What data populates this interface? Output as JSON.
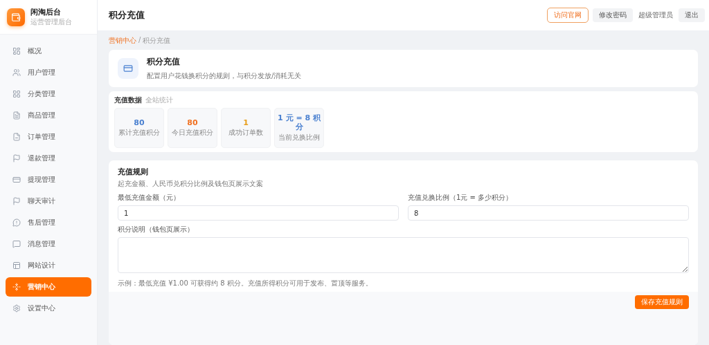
{
  "brand": {
    "title": "闲淘后台",
    "subtitle": "运营管理后台"
  },
  "sidebar": {
    "items": [
      {
        "label": "概况",
        "selected": false
      },
      {
        "label": "用户管理",
        "selected": false
      },
      {
        "label": "分类管理",
        "selected": false
      },
      {
        "label": "商品管理",
        "selected": false
      },
      {
        "label": "订单管理",
        "selected": false
      },
      {
        "label": "退款管理",
        "selected": false
      },
      {
        "label": "提现管理",
        "selected": false
      },
      {
        "label": "聊天审计",
        "selected": false
      },
      {
        "label": "售后管理",
        "selected": false
      },
      {
        "label": "消息管理",
        "selected": false
      },
      {
        "label": "网站设计",
        "selected": false
      },
      {
        "label": "营销中心",
        "selected": true
      },
      {
        "label": "设置中心",
        "selected": false
      }
    ]
  },
  "header": {
    "title": "积分充值",
    "visit_button": "访问官网",
    "password_button": "修改密码",
    "user": "超级管理员",
    "logout_button": "退出"
  },
  "breadcrumb": {
    "parent": "营销中心",
    "separator": "/",
    "current": "积分充值"
  },
  "intro": {
    "title": "积分充值",
    "description": "配置用户花钱换积分的规则，与积分发放/消耗无关"
  },
  "stats": {
    "title": "充值数据",
    "note": "全站统计",
    "cards": [
      {
        "value": "80",
        "label": "累计充值积分",
        "color": "#4a80d0"
      },
      {
        "value": "80",
        "label": "今日充值积分",
        "color": "#f07020"
      },
      {
        "value": "1",
        "label": "成功订单数",
        "color": "#e8a020"
      },
      {
        "value": "1 元 = 8 积分",
        "label": "当前兑换比例",
        "color": "#4a80d0"
      }
    ]
  },
  "rules": {
    "title": "充值规则",
    "description": "起充金额、人民币兑积分比例及钱包页展示文案",
    "min_amount": {
      "label": "最低充值金额（元）",
      "value": "1"
    },
    "ratio": {
      "label": "充值兑换比例（1元 = 多少积分）",
      "value": "8"
    },
    "points_note": {
      "label": "积分说明（钱包页展示）"
    },
    "hint": "示例：最低充值 ¥1.00 可获得约 8 积分。充值所得积分可用于发布、置顶等服务。",
    "save_button": "保存充值规则"
  }
}
